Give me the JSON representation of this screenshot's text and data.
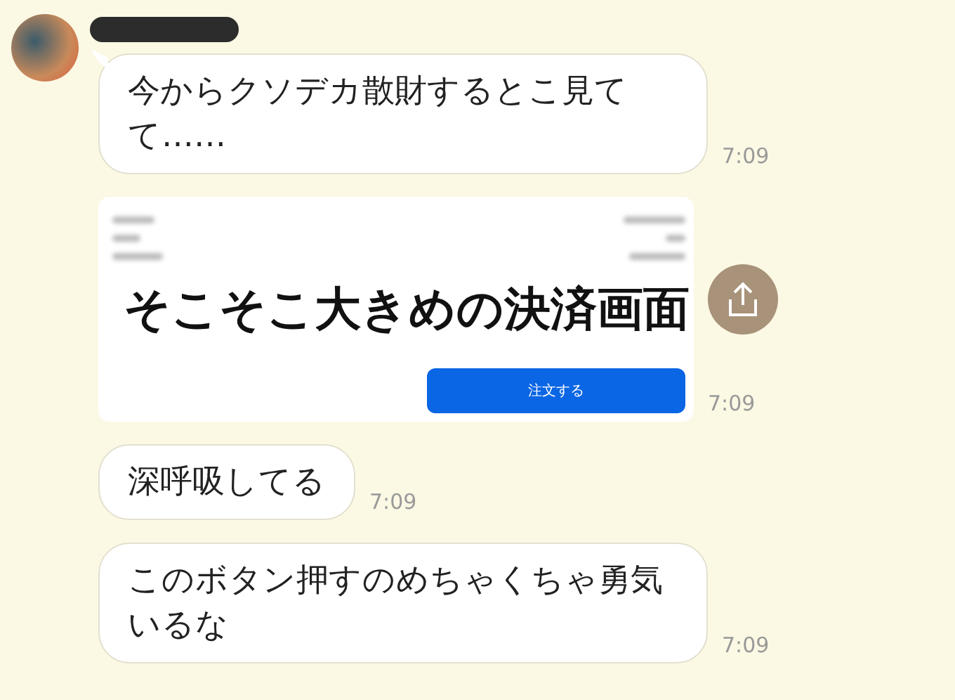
{
  "messages": [
    {
      "kind": "text",
      "text": "今からクソデカ散財するとこ見てて……",
      "time": "7:09"
    },
    {
      "kind": "image",
      "caption": "そこそこ大きめの決済画面",
      "button": "注文する",
      "time": "7:09"
    },
    {
      "kind": "text",
      "text": "深呼吸してる",
      "time": "7:09"
    },
    {
      "kind": "text",
      "text": "このボタン押すのめちゃくちゃ勇気いるな",
      "time": "7:09"
    }
  ]
}
